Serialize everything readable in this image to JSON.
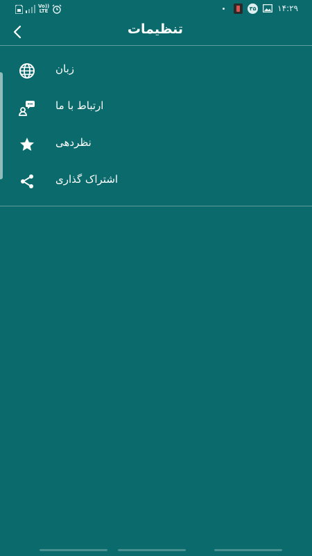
{
  "status_bar": {
    "volte_text": "Vo)) LTE",
    "time": "۱۴:۲۹",
    "notification_count": "۳۵",
    "icons": [
      "sim-icon",
      "signal-icon",
      "alarm-icon",
      "app-notification-icon",
      "image-icon"
    ]
  },
  "app_bar": {
    "title": "تنظیمات",
    "back_icon": "chevron-left-icon"
  },
  "menu": {
    "items": [
      {
        "label": "زبان",
        "icon": "globe-icon"
      },
      {
        "label": "ارتباط با ما",
        "icon": "contact-chat-icon"
      },
      {
        "label": "نظردهی",
        "icon": "star-icon"
      },
      {
        "label": "اشتراک گذاری",
        "icon": "share-icon"
      }
    ]
  },
  "colors": {
    "background": "#0b6a6b",
    "foreground": "#ffffff",
    "divider": "rgba(255,255,255,0.35)"
  }
}
